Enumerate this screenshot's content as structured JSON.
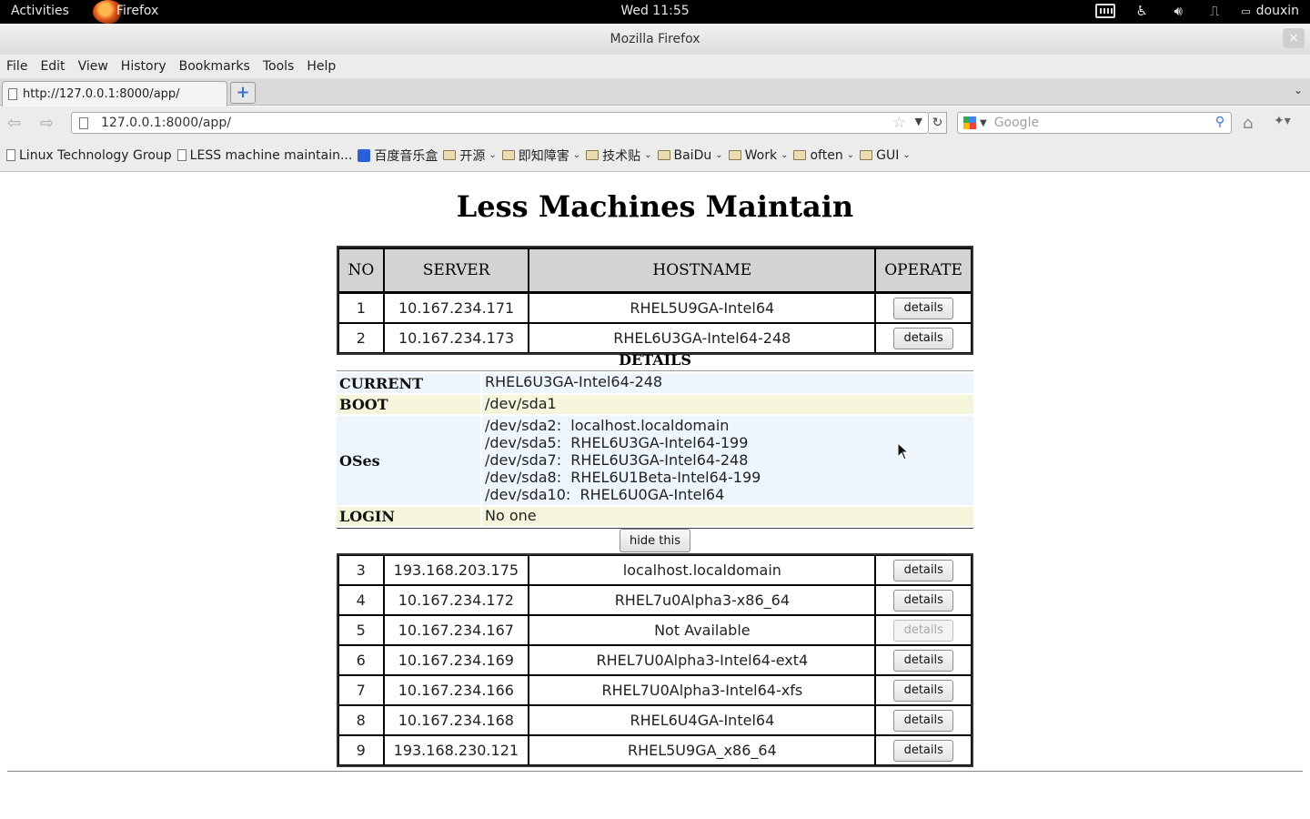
{
  "topbar": {
    "activities": "Activities",
    "app_name": "Firefox",
    "clock": "Wed 11:55",
    "user": "douxin"
  },
  "window": {
    "title": "Mozilla Firefox",
    "close": "×"
  },
  "menu": {
    "file": "File",
    "edit": "Edit",
    "view": "View",
    "history": "History",
    "bookmarks": "Bookmarks",
    "tools": "Tools",
    "help": "Help"
  },
  "tab": {
    "label": "http://127.0.0.1:8000/app/",
    "new_tab": "+",
    "list": "⌄"
  },
  "nav": {
    "url": "127.0.0.1:8000/app/",
    "search_placeholder": "Google"
  },
  "bookmarks": [
    {
      "label": "Linux Technology Group",
      "kind": "page"
    },
    {
      "label": "LESS machine maintain...",
      "kind": "page"
    },
    {
      "label": "百度音乐盒",
      "kind": "baidu"
    },
    {
      "label": "开源",
      "kind": "folder"
    },
    {
      "label": "即知障害",
      "kind": "folder"
    },
    {
      "label": "技术贴",
      "kind": "folder"
    },
    {
      "label": "BaiDu",
      "kind": "folder"
    },
    {
      "label": "Work",
      "kind": "folder"
    },
    {
      "label": "often",
      "kind": "folder"
    },
    {
      "label": "GUI",
      "kind": "folder"
    }
  ],
  "page": {
    "title": "Less Machines Maintain",
    "columns": [
      "NO",
      "SERVER",
      "HOSTNAME",
      "OPERATE"
    ],
    "button_label": "details",
    "rows_top": [
      {
        "no": "1",
        "server": "10.167.234.171",
        "hostname": "RHEL5U9GA-Intel64",
        "enabled": true
      },
      {
        "no": "2",
        "server": "10.167.234.173",
        "hostname": "RHEL6U3GA-Intel64-248",
        "enabled": true
      }
    ],
    "details": {
      "title": "DETAILS",
      "current_label": "CURRENT",
      "current_value": "RHEL6U3GA-Intel64-248",
      "boot_label": "BOOT",
      "boot_value": "/dev/sda1",
      "oses_label": "OSes",
      "oses": [
        "/dev/sda2:  localhost.localdomain",
        "/dev/sda5:  RHEL6U3GA-Intel64-199",
        "/dev/sda7:  RHEL6U3GA-Intel64-248",
        "/dev/sda8:  RHEL6U1Beta-Intel64-199",
        "/dev/sda10:  RHEL6U0GA-Intel64"
      ],
      "login_label": "LOGIN",
      "login_value": "No one",
      "hide_label": "hide this"
    },
    "rows_bottom": [
      {
        "no": "3",
        "server": "193.168.203.175",
        "hostname": "localhost.localdomain",
        "enabled": true
      },
      {
        "no": "4",
        "server": "10.167.234.172",
        "hostname": "RHEL7u0Alpha3-x86_64",
        "enabled": true
      },
      {
        "no": "5",
        "server": "10.167.234.167",
        "hostname": "Not Available",
        "enabled": false
      },
      {
        "no": "6",
        "server": "10.167.234.169",
        "hostname": "RHEL7U0Alpha3-Intel64-ext4",
        "enabled": true
      },
      {
        "no": "7",
        "server": "10.167.234.166",
        "hostname": "RHEL7U0Alpha3-Intel64-xfs",
        "enabled": true
      },
      {
        "no": "8",
        "server": "10.167.234.168",
        "hostname": "RHEL6U4GA-Intel64",
        "enabled": true
      },
      {
        "no": "9",
        "server": "193.168.230.121",
        "hostname": "RHEL5U9GA_x86_64",
        "enabled": true
      }
    ]
  },
  "icons": {
    "back": "back-arrow-icon",
    "forward": "forward-arrow-icon",
    "home": "home-icon",
    "reload": "reload-icon",
    "search": "search-icon",
    "star": "bookmark-star-icon"
  }
}
